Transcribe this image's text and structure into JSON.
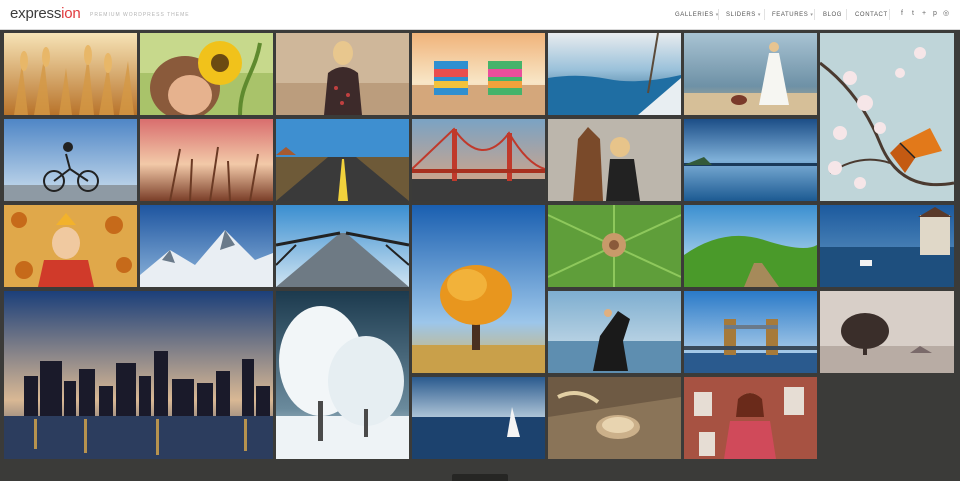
{
  "brand": {
    "name_part1": "express",
    "name_part2": "ion",
    "tagline": "PREMIUM WORDPRESS THEME"
  },
  "nav": {
    "items": [
      {
        "label": "GALLERIES",
        "caret": "▾"
      },
      {
        "label": "SLIDERS",
        "caret": "▾"
      },
      {
        "label": "FEATURES",
        "caret": "▾"
      },
      {
        "label": "BLOG",
        "caret": ""
      },
      {
        "label": "CONTACT",
        "caret": ""
      }
    ],
    "social": [
      {
        "icon": "facebook-icon",
        "glyph": "f"
      },
      {
        "icon": "twitter-icon",
        "glyph": "t"
      },
      {
        "icon": "google-plus-icon",
        "glyph": "+"
      },
      {
        "icon": "pinterest-icon",
        "glyph": "p"
      },
      {
        "icon": "dribbble-icon",
        "glyph": "◎"
      }
    ]
  },
  "gallery": {
    "photos": [
      {
        "name": "wheat-field-photo"
      },
      {
        "name": "girl-with-sunflower-photo"
      },
      {
        "name": "blonde-woman-portrait-photo"
      },
      {
        "name": "beach-chairs-photo"
      },
      {
        "name": "sea-sailboat-photo"
      },
      {
        "name": "woman-white-dress-beach-photo"
      },
      {
        "name": "butterfly-cherry-blossom-photo"
      },
      {
        "name": "cyclist-photo"
      },
      {
        "name": "field-grass-sunset-photo"
      },
      {
        "name": "desert-road-photo"
      },
      {
        "name": "golden-gate-bridge-photo"
      },
      {
        "name": "horse-and-girl-photo"
      },
      {
        "name": "blue-lake-photo"
      },
      {
        "name": "girl-autumn-leaves-photo"
      },
      {
        "name": "snowy-mountains-photo"
      },
      {
        "name": "wooden-pier-photo"
      },
      {
        "name": "autumn-tree-photo"
      },
      {
        "name": "snail-on-leaf-photo"
      },
      {
        "name": "green-hills-boardwalk-photo"
      },
      {
        "name": "harbor-town-photo"
      },
      {
        "name": "city-skyline-night-photo"
      },
      {
        "name": "snow-covered-tree-photo"
      },
      {
        "name": "rearing-horse-photo"
      },
      {
        "name": "tower-bridge-photo"
      },
      {
        "name": "lone-tree-misty-photo"
      },
      {
        "name": "sailboat-sea-photo"
      },
      {
        "name": "oats-in-spoon-photo"
      },
      {
        "name": "woman-red-scarf-photo"
      }
    ]
  }
}
